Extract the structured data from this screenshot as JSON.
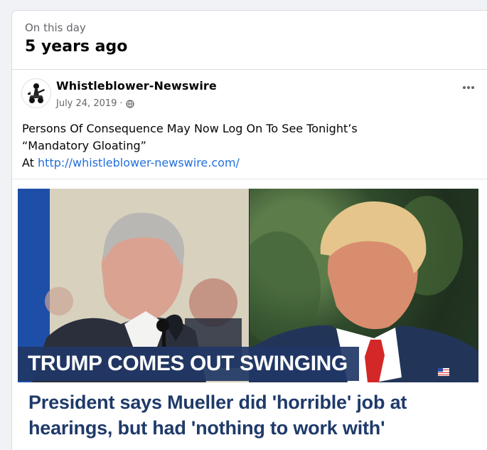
{
  "memory": {
    "subtitle": "On this day",
    "title": "5 years ago"
  },
  "post": {
    "author": "Whistleblower-Newswire",
    "date": "July 24, 2019",
    "separator": "·",
    "privacy_icon": "globe-icon",
    "more_icon": "more-options-icon",
    "text_line1": "Persons Of Consequence May Now Log On To See Tonight’s",
    "text_line2": "“Mandatory Gloating”",
    "text_prefix": "At ",
    "link": "http://whistleblower-newswire.com/"
  },
  "media": {
    "banner": "TRUMP COMES OUT SWINGING",
    "headline_line1": "President says Mueller did 'horrible' job at",
    "headline_line2": "hearings, but had 'nothing to work with'"
  },
  "colors": {
    "page_bg": "#f0f2f5",
    "link": "#216fdb",
    "headline": "#1f3a6a",
    "banner_bg": "#213766"
  }
}
